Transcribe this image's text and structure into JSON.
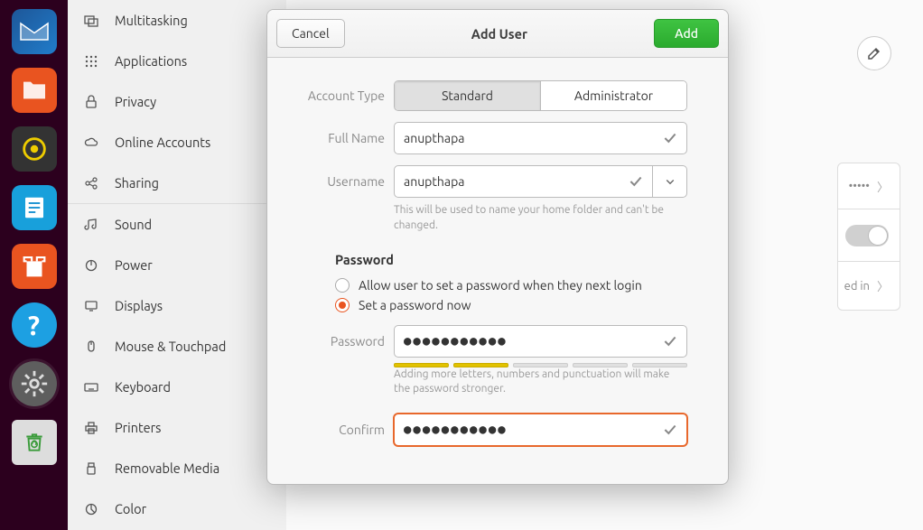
{
  "dock": {
    "items": [
      "thunderbird",
      "files",
      "rhythmbox",
      "writer",
      "software",
      "help",
      "settings",
      "trash"
    ]
  },
  "sidebar": {
    "items": [
      {
        "label": "Multitasking"
      },
      {
        "label": "Applications"
      },
      {
        "label": "Privacy"
      },
      {
        "label": "Online Accounts"
      },
      {
        "label": "Sharing"
      },
      {
        "label": "Sound"
      },
      {
        "label": "Power"
      },
      {
        "label": "Displays"
      },
      {
        "label": "Mouse & Touchpad"
      },
      {
        "label": "Keyboard"
      },
      {
        "label": "Printers"
      },
      {
        "label": "Removable Media"
      },
      {
        "label": "Color"
      }
    ]
  },
  "main_bg": {
    "row1_text": "•••••",
    "row3_text": "ed in"
  },
  "modal": {
    "title": "Add User",
    "cancel": "Cancel",
    "add": "Add",
    "account_type_label": "Account Type",
    "account_type_standard": "Standard",
    "account_type_admin": "Administrator",
    "fullname_label": "Full Name",
    "fullname_value": "anupthapa",
    "username_label": "Username",
    "username_value": "anupthapa",
    "username_help": "This will be used to name your home folder and can't be changed.",
    "password_section": "Password",
    "radio_later": "Allow user to set a password when they next login",
    "radio_now": "Set a password now",
    "password_label": "Password",
    "password_value": "●●●●●●●●●●●",
    "password_help": "Adding more letters, numbers and punctuation will make the password stronger.",
    "confirm_label": "Confirm",
    "confirm_value": "●●●●●●●●●●●"
  }
}
